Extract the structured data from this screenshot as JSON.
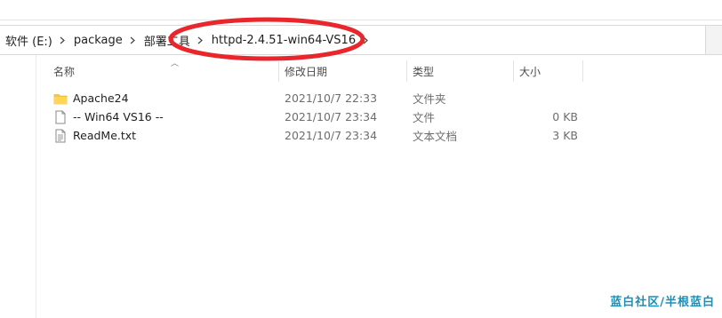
{
  "breadcrumb": {
    "items": [
      "软件 (E:)",
      "package",
      "部署工具",
      "httpd-2.4.51-win64-VS16"
    ]
  },
  "columns": {
    "name": "名称",
    "date": "修改日期",
    "type": "类型",
    "size": "大小"
  },
  "files": [
    {
      "name": "Apache24",
      "date": "2021/10/7 22:33",
      "type": "文件夹",
      "size": "",
      "icon": "folder-icon"
    },
    {
      "name": "-- Win64 VS16  --",
      "date": "2021/10/7 23:34",
      "type": "文件",
      "size": "0 KB",
      "icon": "blank-file-icon"
    },
    {
      "name": "ReadMe.txt",
      "date": "2021/10/7 23:34",
      "type": "文本文档",
      "size": "3 KB",
      "icon": "text-file-icon"
    }
  ],
  "watermark": "蓝白社区/半根蓝白",
  "colors": {
    "annotation": "#e8262c",
    "folder": "#f5c842",
    "watermark": "#1b8fb5"
  }
}
